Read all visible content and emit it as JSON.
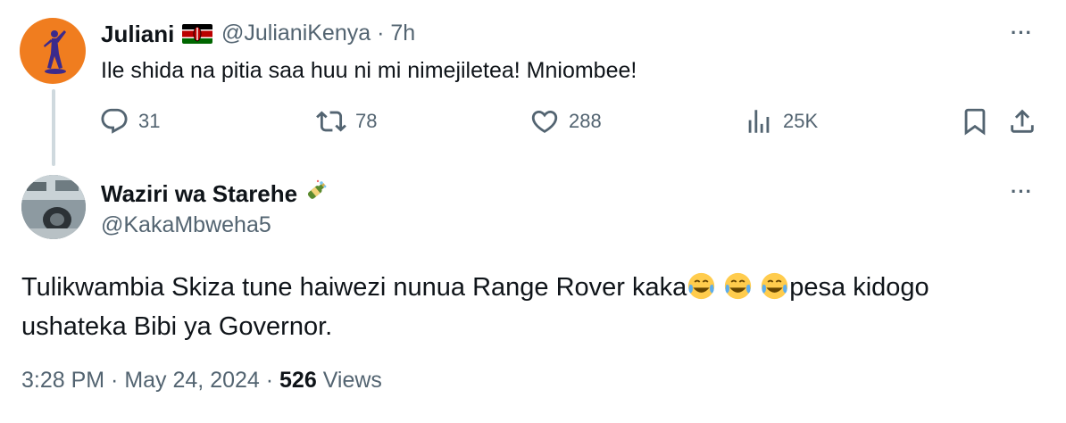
{
  "parent_tweet": {
    "author_name": "Juliani",
    "flag_icon": "kenya-flag-icon",
    "handle": "@JulianiKenya",
    "separator": "·",
    "time": "7h",
    "text": "Ile shida na pitia saa huu ni mi nimejiletea! Mniombee!",
    "more_icon": "···",
    "actions": {
      "replies": "31",
      "reposts": "78",
      "likes": "288",
      "views": "25K"
    },
    "avatar_color": "#f07d1f"
  },
  "reply_tweet": {
    "author_name": "Waziri wa Starehe",
    "name_emoji": "champagne-bottle-icon",
    "handle": "@KakaMbweha5",
    "more_icon": "···",
    "text_part1": "Tulikwambia Skiza tune haiwezi nunua Range Rover kaka",
    "emoji": "face-with-tears-of-joy-icon",
    "text_part2": "pesa kidogo ushateka Bibi ya Governor.",
    "timestamp": "3:28 PM · May 24, 2024 · ",
    "views_count": "526",
    "views_label": " Views"
  },
  "colors": {
    "text": "#0f1419",
    "secondary": "#536471",
    "thread_line": "#cfd9de"
  }
}
